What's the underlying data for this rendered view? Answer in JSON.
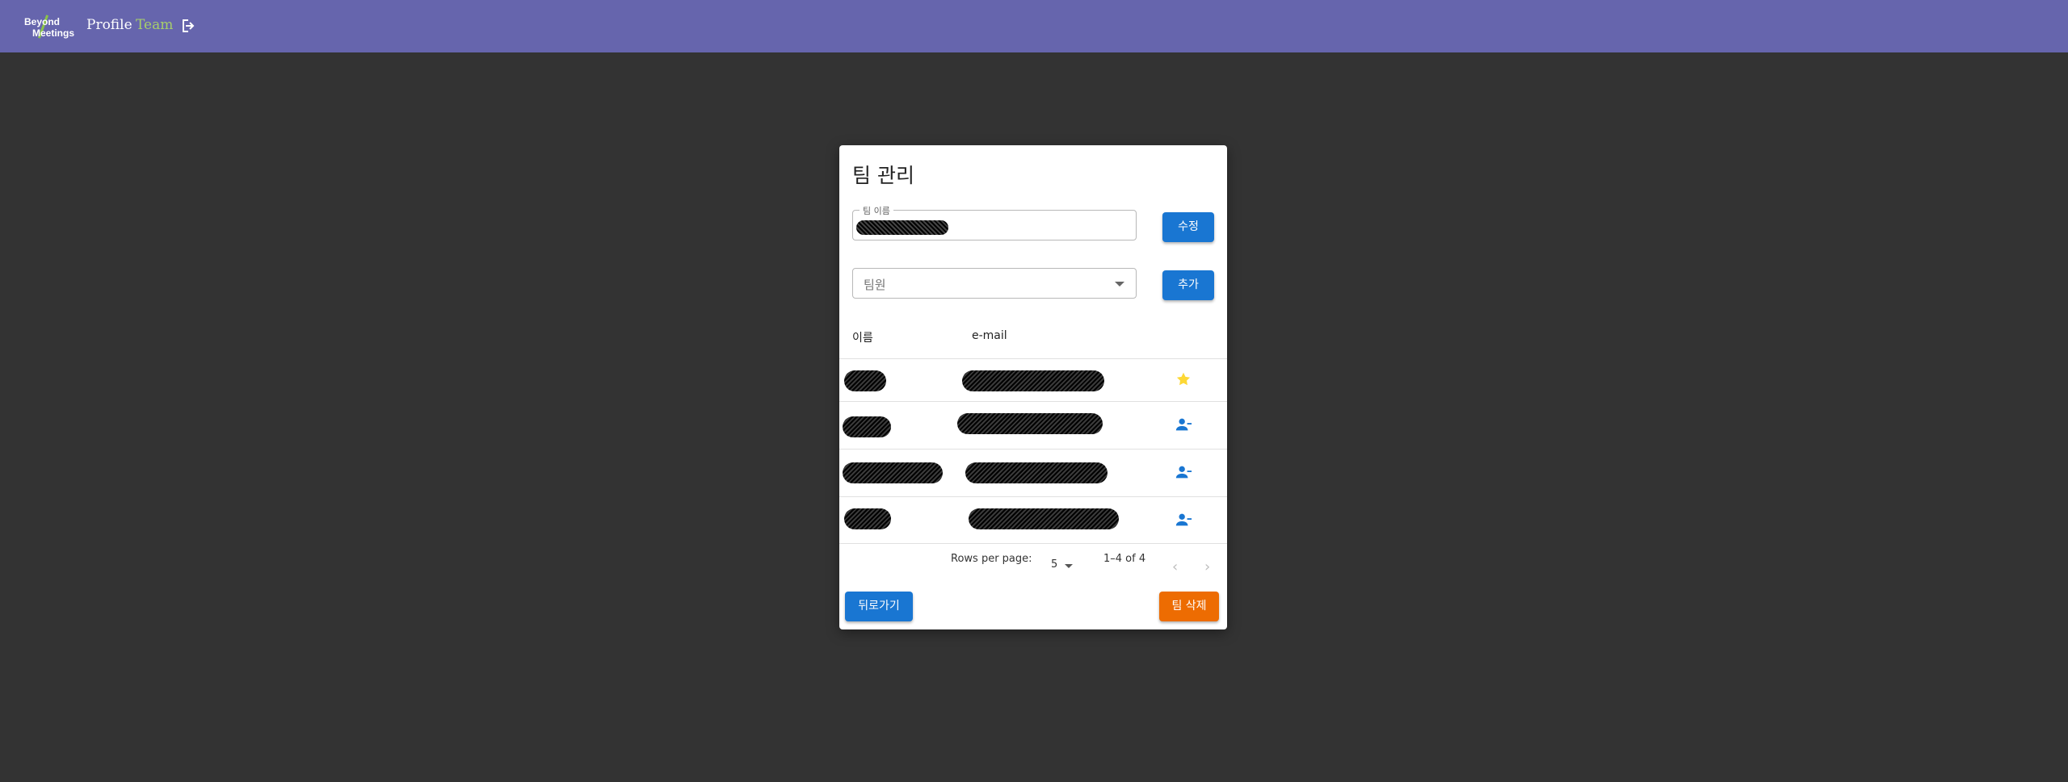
{
  "topbar": {
    "logo_line1": "Beyond",
    "logo_line2": "Meetings",
    "nav_profile": "Profile",
    "nav_team": "Team",
    "logout_icon": "logout-icon",
    "background": "#6665ad"
  },
  "dialog": {
    "title": "팀 관리",
    "team_name_label": "팀 이름",
    "edit_button": "수정",
    "member_select_label": "팀원",
    "add_button": "추가",
    "columns": [
      "이름",
      "e-mail"
    ],
    "rows": [
      {
        "icon": "star-icon",
        "owner": true
      },
      {
        "icon": "remove-member-icon",
        "owner": false
      },
      {
        "icon": "remove-member-icon",
        "owner": false
      },
      {
        "icon": "remove-member-icon",
        "owner": false
      }
    ],
    "pagination": {
      "rows_per_page_label": "Rows per page:",
      "rows_per_page_value": "5",
      "range": "1–4 of 4",
      "prev_icon": "‹",
      "next_icon": "›"
    },
    "back_button": "뒤로가기",
    "delete_button": "팀 삭제"
  },
  "colors": {
    "primary": "#1976d2",
    "warning": "#ed6c02",
    "star": "#fdd835",
    "nav_active": "#a7cf6a"
  }
}
